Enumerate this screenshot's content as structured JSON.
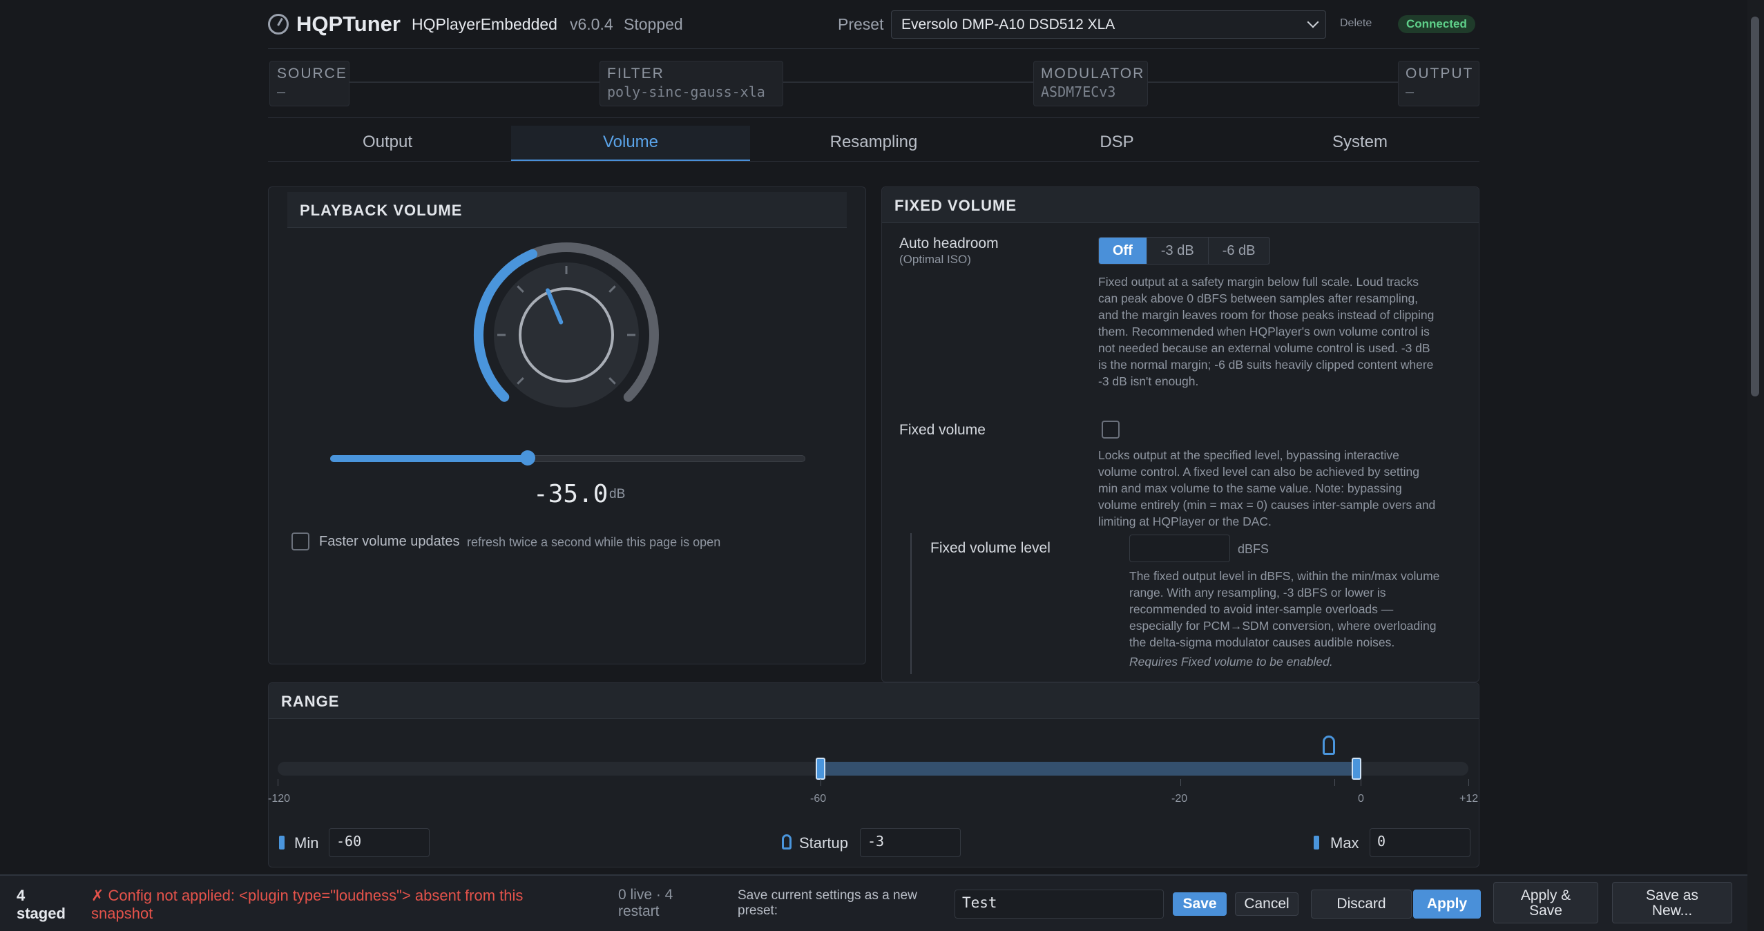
{
  "header": {
    "app_name": "HQPTuner",
    "engine": "HQPlayerEmbedded",
    "version": "v6.0.4",
    "state": "Stopped",
    "preset_label": "Preset",
    "preset_value": "Eversolo DMP-A10 DSD512 XLA",
    "delete_label": "Delete",
    "connection": "Connected"
  },
  "pipeline": [
    {
      "title": "SOURCE",
      "value": "—"
    },
    {
      "title": "FILTER",
      "value": "poly-sinc-gauss-xla"
    },
    {
      "title": "MODULATOR",
      "value": "ASDM7ECv3"
    },
    {
      "title": "OUTPUT",
      "value": "—"
    }
  ],
  "tabs": [
    "Output",
    "Volume",
    "Resampling",
    "DSP",
    "System"
  ],
  "active_tab": "Volume",
  "playback": {
    "title": "PLAYBACK VOLUME",
    "value": "-35.0",
    "unit": "dB",
    "slider_fraction": 0.416,
    "faster_label": "Faster volume updates",
    "faster_hint": "refresh twice a second while this page is open"
  },
  "fixed": {
    "title": "FIXED VOLUME",
    "auto_headroom_label": "Auto headroom",
    "auto_headroom_sub": "(Optimal ISO)",
    "headroom_options": [
      "Off",
      "-3 dB",
      "-6 dB"
    ],
    "headroom_desc_lines": [
      "Fixed output at a safety margin below full scale. Loud tracks",
      "can peak above 0 dBFS between samples after resampling,",
      "and the margin leaves room for those peaks instead of clipping",
      "them. Recommended when HQPlayer's own volume control is",
      "not needed because an external volume control is used. -3 dB",
      "is the normal margin; -6 dB suits heavily clipped content where",
      "-3 dB isn't enough."
    ],
    "fixed_label": "Fixed volume",
    "fixed_desc_lines": [
      "Locks output at the specified level, bypassing interactive",
      "volume control. A fixed level can also be achieved by setting",
      "min and max volume to the same value. Note: bypassing",
      "volume entirely (min = max = 0) causes inter-sample overs and",
      "limiting at HQPlayer or the DAC."
    ],
    "level_label": "Fixed volume level",
    "level_unit": "dBFS",
    "level_desc_lines": [
      "The fixed output level in dBFS, within the min/max volume",
      "range. With any resampling, -3 dBFS or lower is",
      "recommended to avoid inter-sample overloads —",
      "especially for PCM→SDM conversion, where overloading",
      "the delta-sigma modulator causes audible noises."
    ],
    "requires_note": "Requires Fixed volume to be enabled."
  },
  "range": {
    "title": "RANGE",
    "ticks": [
      "-120",
      "-60",
      "-20",
      "0",
      "+12"
    ],
    "min_label": "Min",
    "min_value": "-60",
    "startup_label": "Startup",
    "startup_value": "-3",
    "max_label": "Max",
    "max_value": "0"
  },
  "bottom": {
    "staged_count": "4",
    "staged_label": "staged",
    "error_line1": "✗ Config not applied: <plugin type=\"loudness\"> absent from this",
    "error_line2": "snapshot",
    "live_line1": "0 live · 4",
    "live_line2": "restart",
    "save_prompt_line1": "Save current settings as a new",
    "save_prompt_line2": "preset:",
    "preset_name": "Test",
    "save": "Save",
    "cancel": "Cancel",
    "discard": "Discard",
    "apply": "Apply",
    "apply_save_line1": "Apply &",
    "apply_save_line2": "Save",
    "save_as_line1": "Save as",
    "save_as_line2": "New..."
  },
  "colors": {
    "accent": "#4a90d9",
    "connected": "#5fd08a",
    "error": "#e5534b"
  }
}
